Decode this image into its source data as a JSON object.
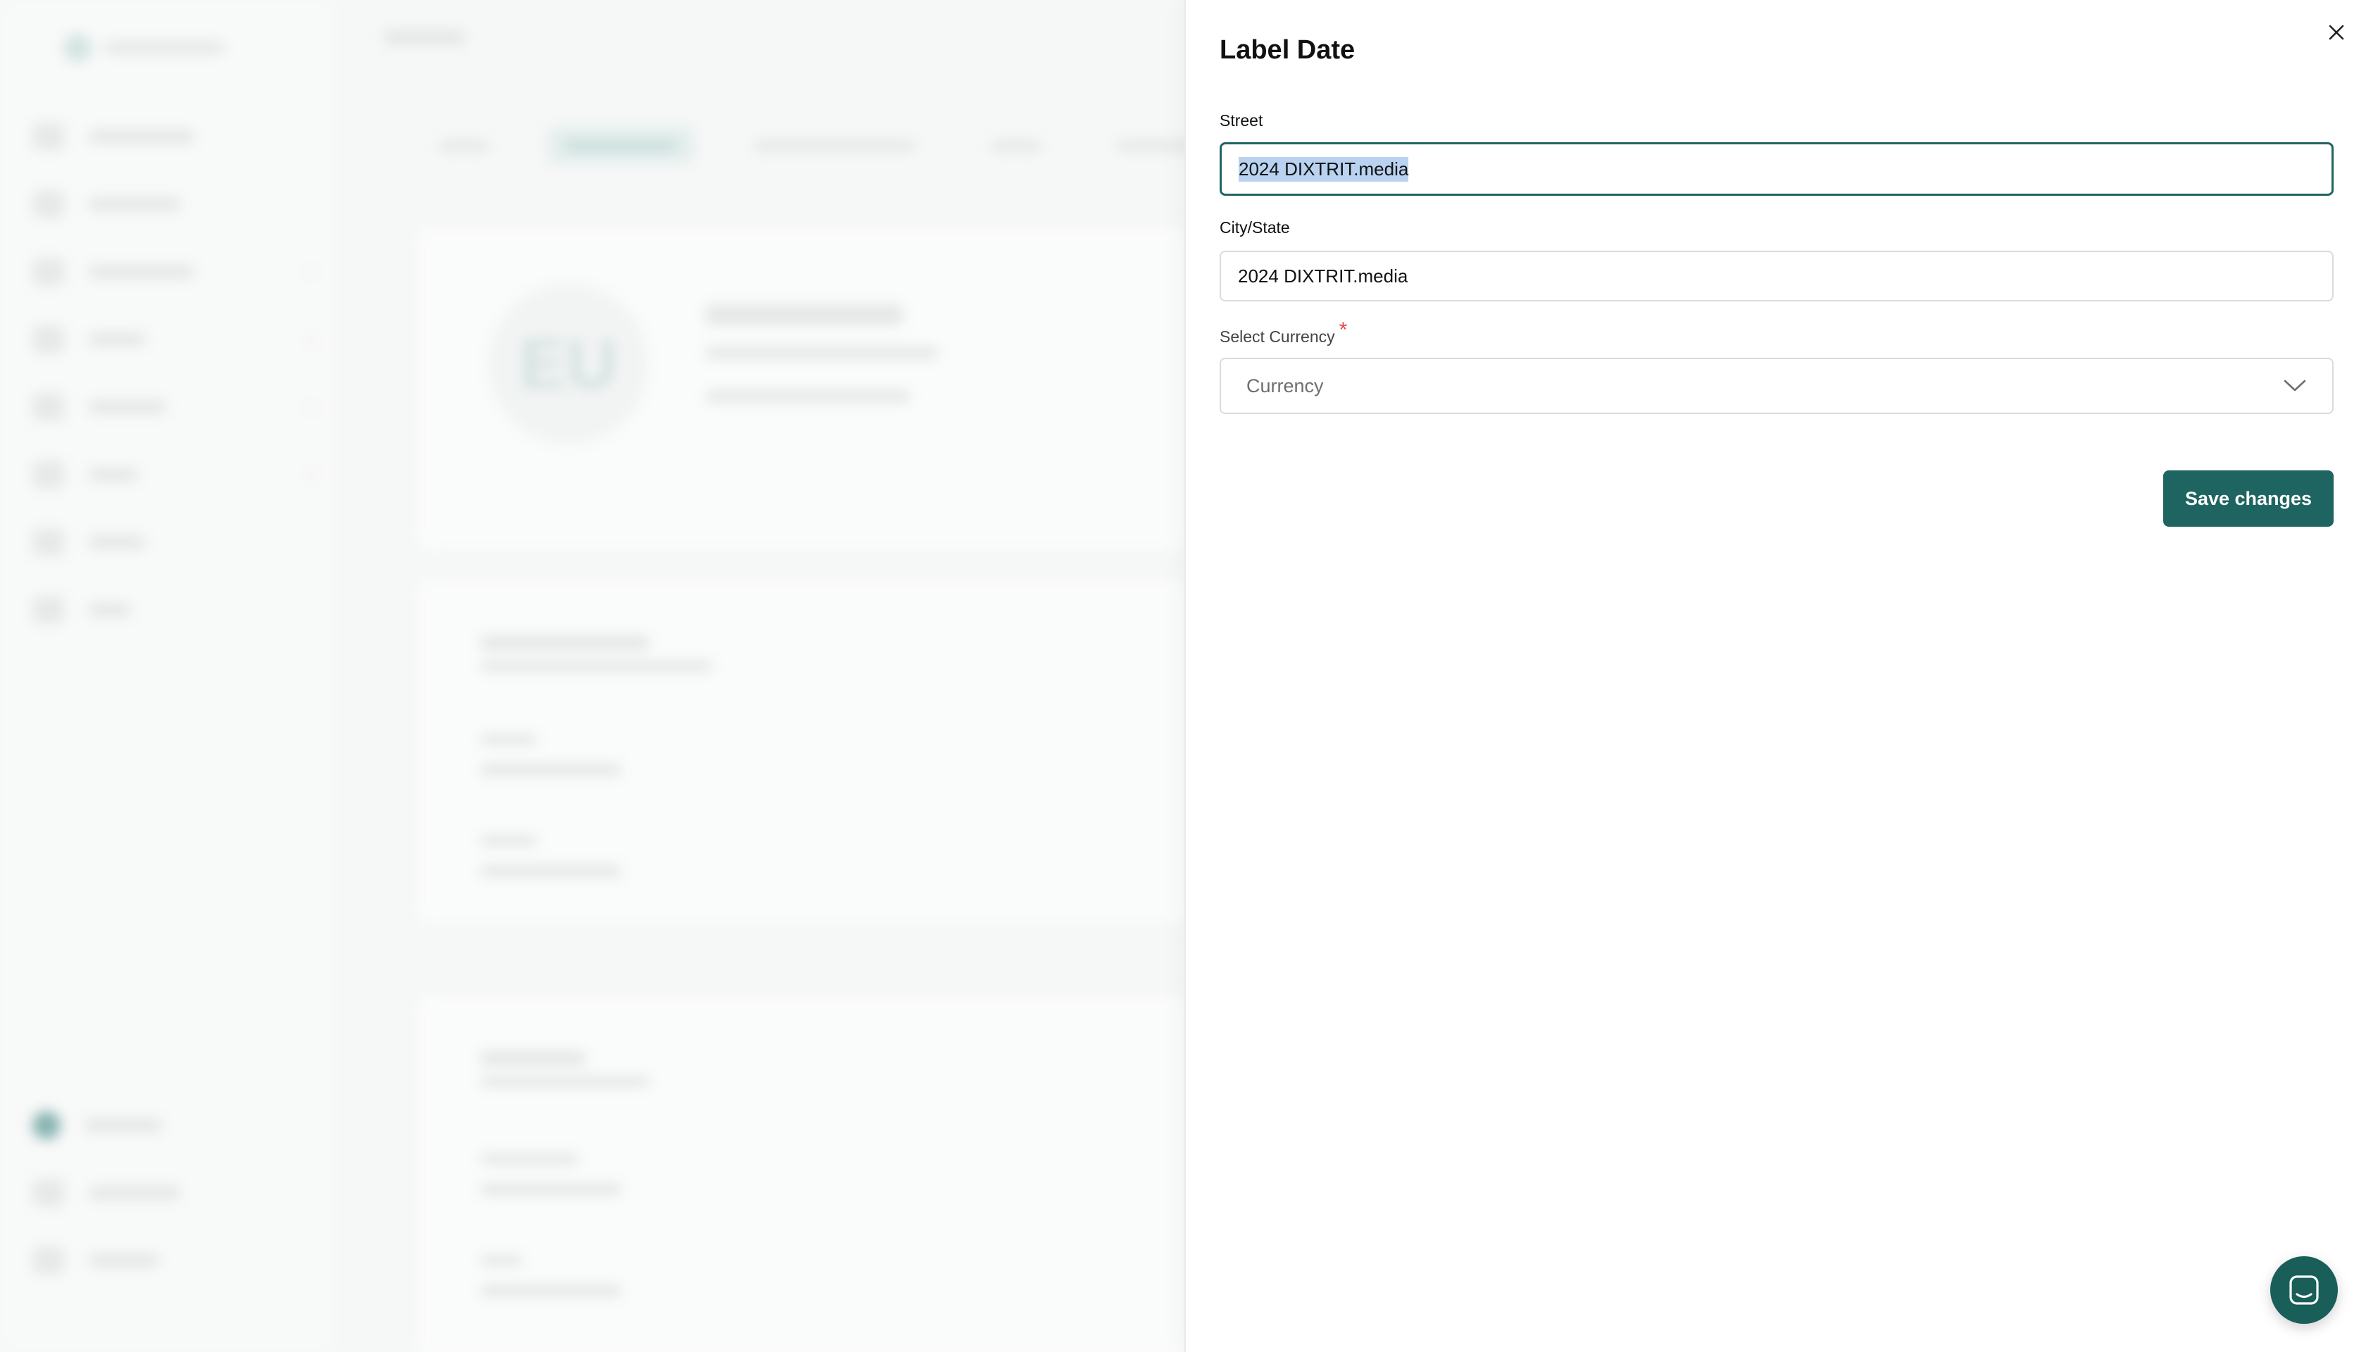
{
  "background": {
    "avatar_initials": "EU"
  },
  "drawer": {
    "title": "Label Date",
    "street": {
      "label": "Street",
      "value": "2024 DIXTRIT.media"
    },
    "city_state": {
      "label": "City/State",
      "value": "2024 DIXTRIT.media"
    },
    "currency": {
      "label": "Select Currency",
      "required_mark": "*",
      "placeholder": "Currency"
    },
    "save_label": "Save changes"
  },
  "colors": {
    "primary": "#1e6461",
    "required": "#e5484d",
    "selection": "#b8d2f0"
  },
  "icons": {
    "close": "close-icon",
    "chevron": "chevron-down-icon",
    "chat": "chat-icon"
  }
}
